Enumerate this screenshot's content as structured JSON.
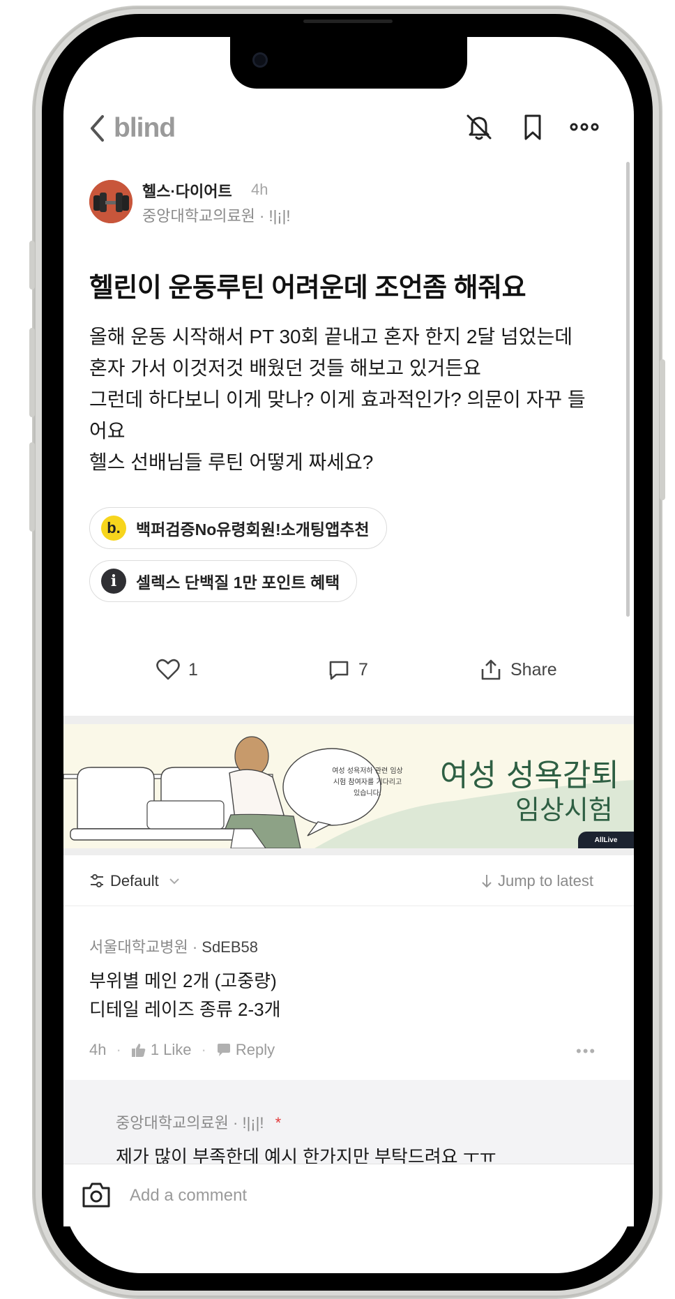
{
  "header": {
    "logo": "blind",
    "back_icon": "chevron-left-icon",
    "icons": [
      "bell-off-icon",
      "bookmark-icon",
      "more-horizontal-icon"
    ]
  },
  "post": {
    "author": {
      "board": "헬스·다이어트",
      "time": "4h",
      "company_nick": "중앙대학교의료원 · !|¡|!"
    },
    "title": "헬린이 운동루틴 어려운데 조언좀 해줘요",
    "body_lines": [
      "올해 운동 시작해서 PT 30회 끝내고 혼자 한지 2달 넘었는데",
      "혼자 가서 이것저것 배웠던 것들 해보고 있거든요",
      "그런데 하다보니 이게 맞나? 이게 효과적인가? 의문이 자꾸 들",
      "어요",
      "헬스 선배님들 루틴 어떻게 짜세요?"
    ],
    "chips": [
      {
        "icon_text": "b.",
        "icon": "b-logo-icon",
        "label": "백퍼검증No유령회원!소개팅앱추천"
      },
      {
        "icon_text": "i",
        "icon": "info-icon",
        "label": "셀렉스 단백질 1만 포인트 혜택"
      }
    ],
    "actions": {
      "like_count": "1",
      "comment_count": "7",
      "share_label": "Share"
    }
  },
  "ad": {
    "bubble_text": "여성 성욕저하 관련 임상시험 참여자를 기다리고 있습니다.",
    "title": "여성 성욕감퇴",
    "subtitle": "임상시험",
    "brand": "AllLive"
  },
  "comments_bar": {
    "sort_label": "Default",
    "jump_label": "Jump to latest"
  },
  "comments": [
    {
      "company": "서울대학교병원",
      "nick": "SdEB58",
      "body_lines": [
        "부위별 메인 2개 (고중량)",
        "디테일 레이즈 종류 2-3개"
      ],
      "time": "4h",
      "like_label": "1 Like",
      "reply_label": "Reply",
      "more": "•••"
    }
  ],
  "reply": {
    "company_nick": "중앙대학교의료원 · !|¡|!",
    "author_mark": "*",
    "body": "제가 많이 부족한데 예시 한가지만 부탁드려요 ㅜㅠ"
  },
  "comment_input": {
    "placeholder": "Add a comment"
  },
  "colors": {
    "accent_green": "#2e5f43",
    "muted_text": "#8a8a8a",
    "chip_b_yellow": "#f7d51d",
    "author_badge_red": "#e23b3b"
  }
}
